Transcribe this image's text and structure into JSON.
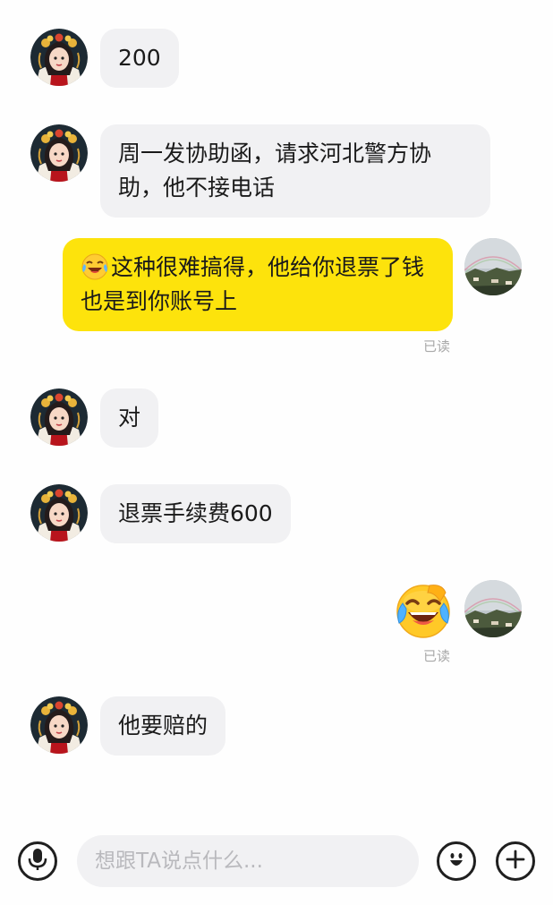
{
  "messages": [
    {
      "side": "in",
      "text": "200"
    },
    {
      "side": "in",
      "text": "周一发协助函，请求河北警方协助，他不接电话"
    },
    {
      "side": "out",
      "emoji": "crying-laughing-face-icon",
      "text": "这种很难搞得，他给你退票了钱也是到你账号上",
      "status": "已读"
    },
    {
      "side": "in",
      "text": "对"
    },
    {
      "side": "in",
      "text": "退票手续费600"
    },
    {
      "side": "out",
      "sticker": "crying-laughing-face-sticker",
      "status": "已读"
    },
    {
      "side": "in",
      "text": "他要赔的"
    }
  ],
  "input": {
    "placeholder": "想跟TA说点什么..."
  },
  "icons": {
    "voice": "microphone-icon",
    "emoji": "smiley-icon",
    "more": "plus-icon"
  },
  "colors": {
    "outgoing_bubble": "#fde30c",
    "incoming_bubble": "#f1f1f3",
    "read_status": "#a8a8a8"
  }
}
